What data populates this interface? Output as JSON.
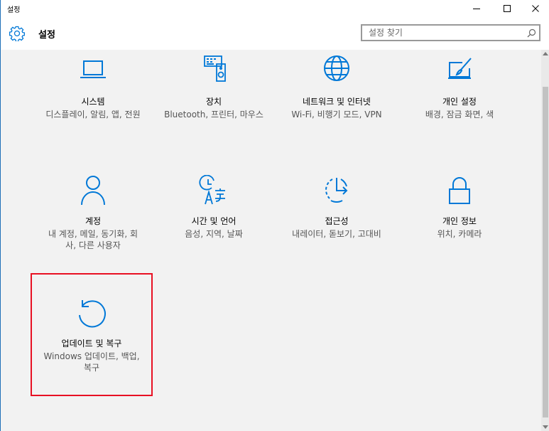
{
  "window": {
    "title": "설정",
    "controls": {
      "minimize_icon": "minimize-icon",
      "maximize_icon": "maximize-icon",
      "close_icon": "close-icon"
    }
  },
  "header": {
    "title": "설정",
    "icon": "gear-icon"
  },
  "search": {
    "placeholder": "설정 찾기",
    "value": "",
    "icon": "search-icon"
  },
  "colors": {
    "accent": "#0078d7",
    "highlight_border": "#e81123",
    "description_text": "#555555"
  },
  "tiles": [
    {
      "title": "시스템",
      "description": "디스플레이, 알림, 앱, 전원",
      "icon": "laptop-icon"
    },
    {
      "title": "장치",
      "description": "Bluetooth, 프린터, 마우스",
      "icon": "devices-icon"
    },
    {
      "title": "네트워크 및 인터넷",
      "description": "Wi-Fi, 비행기 모드, VPN",
      "icon": "globe-icon"
    },
    {
      "title": "개인 설정",
      "description": "배경, 잠금 화면, 색",
      "icon": "personalization-icon"
    },
    {
      "title": "계정",
      "description": "내 계정, 메일, 동기화, 회사, 다른 사용자",
      "icon": "person-icon"
    },
    {
      "title": "시간 및 언어",
      "description": "음성, 지역, 날짜",
      "icon": "time-language-icon"
    },
    {
      "title": "접근성",
      "description": "내레이터, 돋보기, 고대비",
      "icon": "ease-of-access-icon"
    },
    {
      "title": "개인 정보",
      "description": "위치, 카메라",
      "icon": "lock-icon"
    },
    {
      "title": "업데이트 및 복구",
      "description": "Windows 업데이트, 백업, 복구",
      "icon": "update-icon"
    }
  ]
}
